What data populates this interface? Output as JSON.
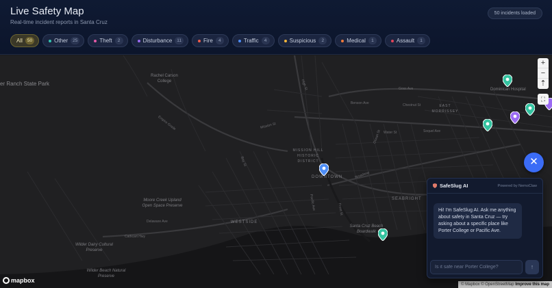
{
  "header": {
    "title": "Live Safety Map",
    "subtitle": "Real-time incident reports in Santa Cruz",
    "incidents_loaded": "50 incidents loaded"
  },
  "filters": [
    {
      "label": "All",
      "count": "50",
      "color": "#f0d36a",
      "active": true
    },
    {
      "label": "Other",
      "count": "25",
      "color": "#34c3b0"
    },
    {
      "label": "Theft",
      "count": "2",
      "color": "#e35aa6"
    },
    {
      "label": "Disturbance",
      "count": "11",
      "color": "#9b6bf2"
    },
    {
      "label": "Fire",
      "count": "4",
      "color": "#ef5b4a"
    },
    {
      "label": "Traffic",
      "count": "4",
      "color": "#4d8df6"
    },
    {
      "label": "Suspicious",
      "count": "2",
      "color": "#f0b43c"
    },
    {
      "label": "Medical",
      "count": "1",
      "color": "#f07a3c"
    },
    {
      "label": "Assault",
      "count": "1",
      "color": "#e0455a"
    }
  ],
  "map": {
    "labels": {
      "ranch_park": "er Ranch State Park",
      "rachel_carson": "Rachel Carson College",
      "moore_creek": "Moore Creek Upland Open Space Preserve",
      "wilder_dairy": "Wilder Dairy Cultural Preserve",
      "wilder_beach": "Wilder Beach Natural Preserve",
      "mission_hill": "MISSION HILL HISTORIC DISTRICT",
      "downtown": "DOWNTOWN",
      "westside": "WESTSIDE",
      "seabright": "SEABRIGHT",
      "east_morrissey": "EAST MORRISSEY",
      "dominican": "Dominican Hospital",
      "boardwalk": "Santa Cruz Beach Boardwalk"
    },
    "roads": {
      "empire_grade": "Empire Grade",
      "cathcart": "Cathcart Hwy",
      "bay_st": "Bay St",
      "high_st": "High St",
      "goss": "Goss Ave",
      "benson": "Benson Ave",
      "chestnut": "Chestnut St",
      "water": "Water St",
      "soquel": "Soquel Ave",
      "broadway": "Broadway",
      "ocean": "Ocean St",
      "pacific": "Pacific Ave",
      "front": "Front St",
      "delaware": "Delaware Ave",
      "mission": "Mission St"
    },
    "controls": {
      "zoom_in": "+",
      "zoom_out": "−",
      "reset": "⇡",
      "fullscreen": "⛶"
    },
    "attribution": "© Mapbox © OpenStreetMap",
    "improve": "Improve this map",
    "logo": "mapbox"
  },
  "chat": {
    "close": "✕",
    "title": "SafeSlug AI",
    "powered_by": "Powered by NemoClaw",
    "greeting": "Hi! I'm SafeSlug AI. Ask me anything about safety in Santa Cruz — try asking about a specific place like Porter College or Pacific Ave.",
    "input_placeholder": "Is it safe near Porter College?",
    "send": "↑"
  }
}
